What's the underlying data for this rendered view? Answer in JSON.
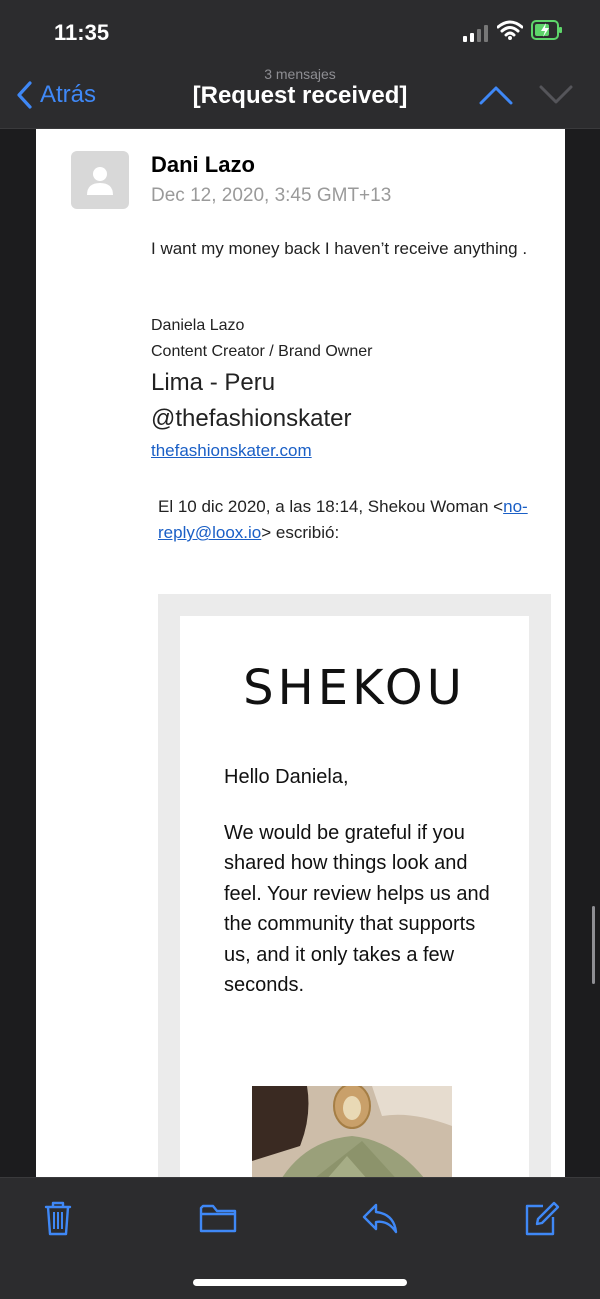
{
  "status": {
    "time": "11:35"
  },
  "nav": {
    "back_label": "Atrás",
    "subtitle": "3 mensajes",
    "title": "[Request received]"
  },
  "email": {
    "sender": "Dani Lazo",
    "date": "Dec 12, 2020, 3:45 GMT+13",
    "body": "I want my money back I haven’t receive anything .",
    "signature": {
      "name": "Daniela Lazo",
      "role": "Content Creator / Brand Owner",
      "city": "Lima - Peru",
      "handle": "@thefashionskater",
      "link": "thefashionskater.com"
    },
    "quote_header": {
      "prefix": "El 10 dic 2020, a las 18:14, Shekou Woman <",
      "email": "no-reply@loox.io",
      "suffix": "> escribió:"
    },
    "quoted": {
      "brand": "SHEKOU",
      "greeting": "Hello Daniela,",
      "message": "We would be grateful if you shared how things look and feel. Your review helps us and the community that supports us, and it only takes a few seconds."
    }
  },
  "colors": {
    "accent": "#3f88f6",
    "link": "#1a5fc6",
    "chrome": "#2c2c2e",
    "battery": "#5ed56a"
  },
  "toolbar": {
    "icons": [
      "trash-icon",
      "folder-icon",
      "reply-icon",
      "compose-icon"
    ]
  }
}
